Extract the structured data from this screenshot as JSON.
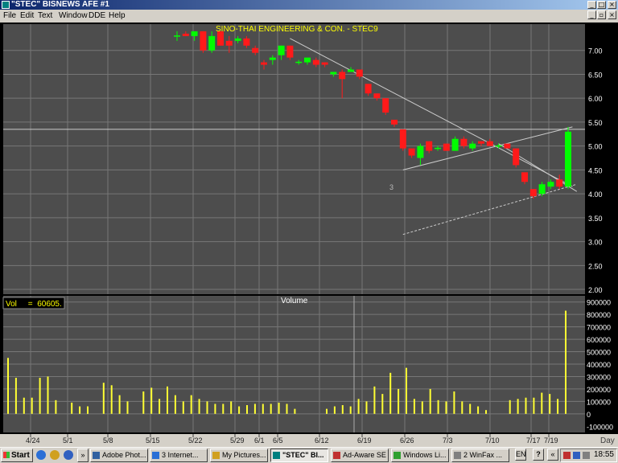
{
  "window": {
    "title": "\"STEC\" BISNEWS AFE #1",
    "min": "_",
    "max": "□",
    "close": "×"
  },
  "menu": [
    "File",
    "Edit",
    "Text",
    "Window",
    "DDE",
    "Help"
  ],
  "chart_title": "SINO-THAI ENGINEERING & CON. - STEC9",
  "vol_readout": "Vol     =  60605.",
  "volume_title": "Volume",
  "pattern_marker": "3",
  "price_axis": {
    "labels": [
      "7.00",
      "6.50",
      "6.00",
      "5.50",
      "5.00",
      "4.50",
      "4.00",
      "3.50",
      "3.00",
      "2.50",
      "2.00"
    ]
  },
  "volume_axis": {
    "labels": [
      "900000",
      "800000",
      "700000",
      "600000",
      "500000",
      "400000",
      "300000",
      "200000",
      "100000",
      "0",
      "-100000"
    ]
  },
  "date_labels": [
    "4/24",
    "5/1",
    "5/8",
    "5/15",
    "5/22",
    "5/29",
    "6/1",
    "6/5",
    "6/12",
    "6/19",
    "6/26",
    "7/3",
    "7/10",
    "7/17",
    "7/19"
  ],
  "interval": "Day",
  "colors": {
    "up": "#00ff00",
    "down": "#ff1a1a",
    "volume": "#ffff33",
    "grid": "#777777",
    "axis_text": "#ffffff",
    "title_text": "#ffff00",
    "pane_bg": "#000000"
  },
  "taskbar": {
    "start": "Start",
    "tasks": [
      "Adobe Phot...",
      "3 Internet...",
      "My Pictures...",
      "\"STEC\" BI...",
      "Ad-Aware SE",
      "Windows Li...",
      "2 WinFax ..."
    ],
    "lang": "EN",
    "clock": "18:55"
  },
  "chart_data": [
    {
      "type": "candlestick",
      "title": "SINO-THAI ENGINEERING & CON. - STEC9",
      "ylim": [
        1.9,
        7.55
      ],
      "y_ticks": [
        2.0,
        2.5,
        3.0,
        3.5,
        4.0,
        4.5,
        5.0,
        5.5,
        6.0,
        6.5,
        7.0
      ],
      "candles": [
        {
          "o": 7.3,
          "h": 7.4,
          "l": 7.2,
          "c": 7.3
        },
        {
          "o": 7.35,
          "h": 7.4,
          "l": 7.3,
          "c": 7.3
        },
        {
          "o": 7.3,
          "h": 7.4,
          "l": 7.2,
          "c": 7.4
        },
        {
          "o": 7.4,
          "h": 7.4,
          "l": 6.95,
          "c": 7.0
        },
        {
          "o": 7.0,
          "h": 7.4,
          "l": 6.95,
          "c": 7.3
        },
        {
          "o": 7.4,
          "h": 7.4,
          "l": 7.1,
          "c": 7.1
        },
        {
          "o": 7.2,
          "h": 7.3,
          "l": 6.95,
          "c": 7.1
        },
        {
          "o": 7.2,
          "h": 7.3,
          "l": 7.15,
          "c": 7.25
        },
        {
          "o": 7.25,
          "h": 7.3,
          "l": 7.05,
          "c": 7.1
        },
        {
          "o": 7.05,
          "h": 7.1,
          "l": 6.9,
          "c": 6.95
        },
        {
          "o": 6.75,
          "h": 6.8,
          "l": 6.6,
          "c": 6.7
        },
        {
          "o": 6.8,
          "h": 6.9,
          "l": 6.7,
          "c": 6.85
        },
        {
          "o": 6.9,
          "h": 7.1,
          "l": 6.8,
          "c": 7.1
        },
        {
          "o": 7.1,
          "h": 7.1,
          "l": 6.8,
          "c": 6.85
        },
        {
          "o": 6.75,
          "h": 6.8,
          "l": 6.7,
          "c": 6.75
        },
        {
          "o": 6.75,
          "h": 6.85,
          "l": 6.7,
          "c": 6.85
        },
        {
          "o": 6.8,
          "h": 6.85,
          "l": 6.65,
          "c": 6.7
        },
        {
          "o": 6.75,
          "h": 6.75,
          "l": 6.65,
          "c": 6.7
        },
        {
          "o": 6.5,
          "h": 6.55,
          "l": 6.45,
          "c": 6.55
        },
        {
          "o": 6.55,
          "h": 6.6,
          "l": 6.0,
          "c": 6.4
        },
        {
          "o": 6.55,
          "h": 6.65,
          "l": 6.55,
          "c": 6.6
        },
        {
          "o": 6.6,
          "h": 6.6,
          "l": 6.4,
          "c": 6.45
        },
        {
          "o": 6.3,
          "h": 6.3,
          "l": 6.05,
          "c": 6.1
        },
        {
          "o": 6.1,
          "h": 6.1,
          "l": 5.95,
          "c": 6.0
        },
        {
          "o": 6.0,
          "h": 6.0,
          "l": 5.65,
          "c": 5.7
        },
        {
          "o": 5.55,
          "h": 5.55,
          "l": 5.4,
          "c": 5.45
        },
        {
          "o": 5.35,
          "h": 5.35,
          "l": 4.9,
          "c": 4.95
        },
        {
          "o": 4.95,
          "h": 4.95,
          "l": 4.75,
          "c": 4.8
        },
        {
          "o": 4.75,
          "h": 5.05,
          "l": 4.6,
          "c": 5.0
        },
        {
          "o": 5.1,
          "h": 5.1,
          "l": 4.85,
          "c": 4.9
        },
        {
          "o": 4.95,
          "h": 5.0,
          "l": 4.9,
          "c": 4.95
        },
        {
          "o": 5.05,
          "h": 5.05,
          "l": 4.9,
          "c": 4.9
        },
        {
          "o": 4.9,
          "h": 5.2,
          "l": 4.9,
          "c": 5.15
        },
        {
          "o": 5.15,
          "h": 5.2,
          "l": 4.95,
          "c": 5.0
        },
        {
          "o": 4.95,
          "h": 5.1,
          "l": 4.9,
          "c": 5.05
        },
        {
          "o": 5.1,
          "h": 5.1,
          "l": 5.0,
          "c": 5.05
        },
        {
          "o": 5.1,
          "h": 5.15,
          "l": 5.0,
          "c": 5.0
        },
        {
          "o": 5.0,
          "h": 5.05,
          "l": 4.95,
          "c": 5.0
        },
        {
          "o": 5.05,
          "h": 5.05,
          "l": 4.95,
          "c": 4.95
        },
        {
          "o": 4.95,
          "h": 4.95,
          "l": 4.55,
          "c": 4.6
        },
        {
          "o": 4.45,
          "h": 4.45,
          "l": 4.2,
          "c": 4.25
        },
        {
          "o": 4.1,
          "h": 4.1,
          "l": 3.9,
          "c": 3.95
        },
        {
          "o": 4.0,
          "h": 4.25,
          "l": 3.95,
          "c": 4.2
        },
        {
          "o": 4.15,
          "h": 4.3,
          "l": 4.1,
          "c": 4.25
        },
        {
          "o": 4.3,
          "h": 4.4,
          "l": 4.1,
          "c": 4.15
        },
        {
          "o": 4.15,
          "h": 5.4,
          "l": 4.1,
          "c": 5.3
        }
      ],
      "horizontal_line": 5.35,
      "trendlines": [
        {
          "from": [
            13,
            7.25
          ],
          "to": [
            45.5,
            4.15
          ],
          "style": "solid"
        },
        {
          "from": [
            26,
            4.5
          ],
          "to": [
            45.5,
            5.4
          ],
          "style": "solid"
        },
        {
          "from": [
            37,
            5.05
          ],
          "to": [
            46,
            4.05
          ],
          "style": "solid"
        },
        {
          "from": [
            26,
            3.15
          ],
          "to": [
            46,
            4.2
          ],
          "style": "dashed"
        }
      ]
    },
    {
      "type": "bar",
      "title": "Volume",
      "ylim": [
        -150000,
        950000
      ],
      "values": [
        450000,
        290000,
        130000,
        130000,
        290000,
        300000,
        110000,
        0,
        90000,
        60000,
        60000,
        0,
        250000,
        230000,
        150000,
        100000,
        0,
        180000,
        210000,
        120000,
        220000,
        150000,
        100000,
        150000,
        120000,
        100000,
        80000,
        80000,
        100000,
        60000,
        70000,
        80000,
        80000,
        80000,
        90000,
        80000,
        40000,
        0,
        0,
        0,
        40000,
        60000,
        70000,
        60000,
        120000,
        100000,
        220000,
        160000,
        330000,
        200000,
        370000,
        120000,
        100000,
        200000,
        110000,
        100000,
        180000,
        100000,
        80000,
        60000,
        30000,
        0,
        0,
        110000,
        120000,
        130000,
        130000,
        170000,
        160000,
        120000,
        830000
      ]
    }
  ]
}
